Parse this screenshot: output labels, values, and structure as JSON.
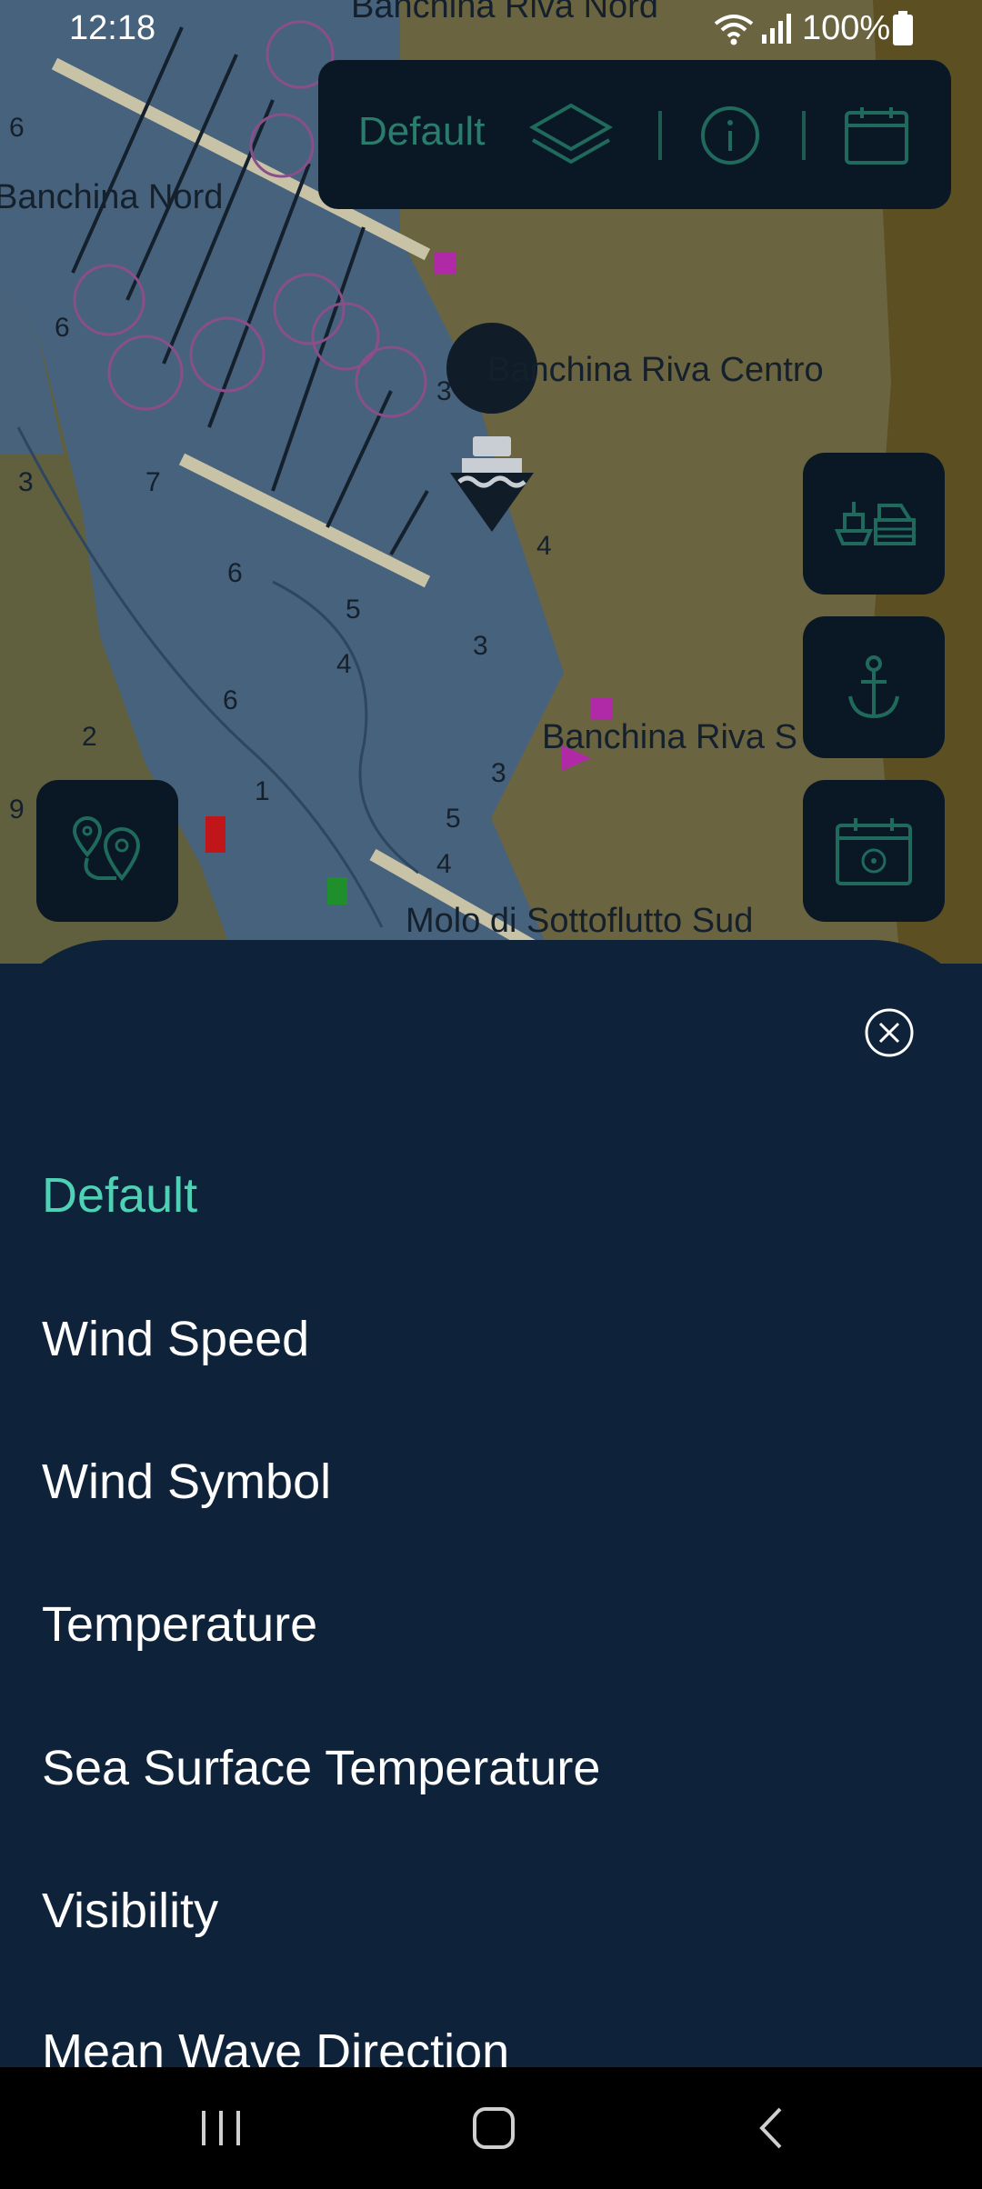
{
  "status_bar": {
    "time": "12:18",
    "battery": "100%",
    "icons": [
      "wifi-icon",
      "signal-icon",
      "battery-icon"
    ]
  },
  "map": {
    "labels": [
      "Banchina Riva Nord",
      "Banchina Nord",
      "Banchina Riva Centro",
      "Banchina Riva S",
      "Molo di Sottoflutto Sud"
    ]
  },
  "toolbar": {
    "layer_name": "Default",
    "icons": [
      "layers-icon",
      "info-icon",
      "calendar-icon"
    ]
  },
  "fabs": [
    "port-services-icon",
    "anchor-icon",
    "calendar-helm-icon",
    "route-pin-icon"
  ],
  "sheet": {
    "close_icon": "close-icon",
    "options": [
      {
        "label": "Default",
        "selected": true
      },
      {
        "label": "Wind Speed",
        "selected": false
      },
      {
        "label": "Wind Symbol",
        "selected": false
      },
      {
        "label": "Temperature",
        "selected": false
      },
      {
        "label": "Sea Surface Temperature",
        "selected": false
      },
      {
        "label": "Visibility",
        "selected": false
      },
      {
        "label": "Mean Wave Direction",
        "selected": false
      }
    ]
  },
  "nav_bar": {
    "icons": [
      "recents-icon",
      "home-icon",
      "back-icon"
    ]
  },
  "colors": {
    "accent": "#4fd1b5",
    "sheet_bg": "#0e2239",
    "panel_bg": "#0a1826"
  }
}
